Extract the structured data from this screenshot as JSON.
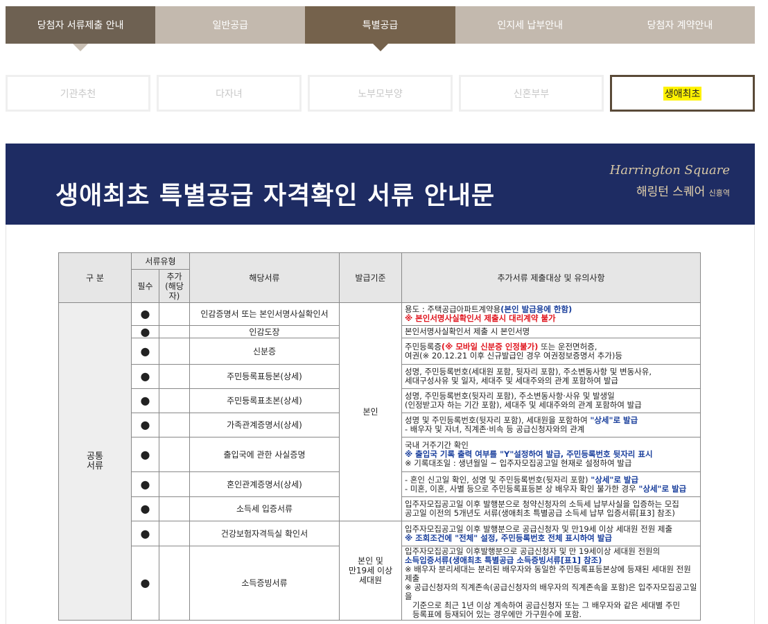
{
  "main_tabs": [
    {
      "label": "당첨자 서류제출 안내"
    },
    {
      "label": "일반공급"
    },
    {
      "label": "특별공급"
    },
    {
      "label": "인지세 납부안내"
    },
    {
      "label": "당첨자 계약안내"
    }
  ],
  "sub_tabs": [
    {
      "label": "기관추천"
    },
    {
      "label": "다자녀"
    },
    {
      "label": "노부모부양"
    },
    {
      "label": "신혼부부"
    },
    {
      "label": "생애최초"
    }
  ],
  "banner": {
    "title": "생애최초 특별공급 자격확인 서류 안내문",
    "logo_script": "Harrington Square",
    "logo_kr": "해링턴 스퀘어",
    "logo_kr_sub": "신흥역",
    "bg_color": "#1e2c63"
  },
  "table": {
    "headers": {
      "category": "구 분",
      "doc_type": "서류유형",
      "required": "필수",
      "additional": "추가\n(해당자)",
      "document": "해당서류",
      "issuer": "발급기준",
      "notes": "추가서류 제출대상 및 유의사항"
    },
    "category_label": "공통\n서류",
    "issuer_self": "본인",
    "issuer_family": "본인 및\n만19세 이상\n세대원",
    "dot": "●",
    "rows": [
      {
        "doc": "인감증명서 또는 본인서명사실확인서",
        "n1": "용도 : 주택공급아파트계약용",
        "n1b": "(본인 발급용에 한함)",
        "n2": "※ 본인서명사실확인서 제출시 대리계약 불가"
      },
      {
        "doc": "인감도장",
        "n1": "본인서명사실확인서 제출 시 본인서명"
      },
      {
        "doc": "신분증",
        "n1": "주민등록증",
        "n1b": "(※ 모바일 신분증 인정불가)",
        "n1c": " 또는 운전면허증,",
        "n2": "여권(※ 20.12.21 이후 신규발급인 경우 여권정보증명서 추가)등"
      },
      {
        "doc": "주민등록표등본(상세)",
        "n1": "성명, 주민등록번호(세대원 포함, 뒷자리 포함), 주소변동사항 및 변동사유,",
        "n2": "세대구성사유 및 일자, 세대주 및 세대주와의 관계 포함하여 발급"
      },
      {
        "doc": "주민등록표초본(상세)",
        "n1": "성명, 주민등록번호(뒷자리 포함), 주소변동사항·사유 및 발생일",
        "n2": "(인정받고자 하는 기간 포함), 세대주 및 세대주와의 관계 포함하여 발급"
      },
      {
        "doc": "가족관계증명서(상세)",
        "n1": "성명 및 주민등록번호(뒷자리 포함), 세대원을 포함하여 ",
        "n1b": "\"상세\"로 발급",
        "n2": "- 배우자 및 자녀, 직계존·비속 등 공급신청자와의 관계"
      },
      {
        "doc": "출입국에 관한 사실증명",
        "n1": "국내 거주기간 확인",
        "n2": "※ 출입국 기록 출력 여부를 \"Y\"설정하여 발급, 주민등록번호 뒷자리 표시",
        "n3": "※ 기록대조일 : 생년월일 ~ 입주자모집공고일 현재로 설정하여 발급"
      },
      {
        "doc": "혼인관계증명서(상세)",
        "n1": "- 혼인 신고일 확인, 성명 및 주민등록번호(뒷자리 포함) ",
        "n1b": "\"상세\"로 발급",
        "n2": "- 미혼, 이혼, 사별 등으로 주민등록표등본 상 배우자 확인 불가한 경우 ",
        "n2b": "\"상세\"로 발급"
      },
      {
        "doc": "소득세 입증서류",
        "n1": "입주자모집공고일 이후 발행분으로 청약신청자의 소득세 납부사실을 입증하는 모집",
        "n2": "공고일 이전의 5개년도 서류(생애최초 특별공급 소득세 납부 입증서류[표3] 참조)"
      },
      {
        "doc": "건강보험자격득실 확인서",
        "n1": "입주자모집공고일 이후 발행분으로 공급신청자 및 만19세 이상 세대원 전원 제출",
        "n2": "※ 조회조건에 \"전체\" 설정, 주민등록번호 전체 표시하여 발급"
      },
      {
        "doc": "소득증빙서류",
        "n1": "입주자모집공고일 이후발행분으로 공급신청자 및 만 19세이상 세대원 전원의",
        "n2": "소득입증서류(생애최초 특별공급 소득증빙서류[표1] 참조)",
        "n3": "※ 배우자 분리세대는 분리된 배우자와 동일한 주민등록표등본상에 등재된 세대원 전원제출",
        "n4": "※ 공급신청자의 직계존속(공급신청자의 배우자의 직계존속을 포함)은 입주자모집공고일을",
        "n5": "기준으로 최근 1년 이상 계속하여 공급신청자 또는 그 배우자와 같은 세대별 주민",
        "n6": "등록표에 등재되어 있는 경우에만 가구원수에 포함."
      }
    ]
  }
}
